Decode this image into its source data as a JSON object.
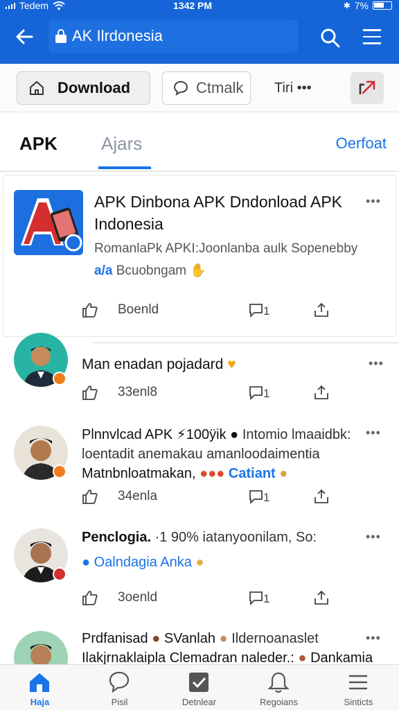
{
  "status_bar": {
    "carrier": "Tedem",
    "time": "1342 PM",
    "battery": "7%"
  },
  "app_bar": {
    "address": "AK Ilrdonesia"
  },
  "actions": {
    "download_label": "Download",
    "comment_label": "Ctmalk",
    "tiri_label": "Tiri •••"
  },
  "tabs": {
    "apk": "APK",
    "ajars": "Ajars",
    "download": "Oerfoat"
  },
  "featured": {
    "title_line1": "APK Dinbona APK Dndonload APK",
    "title_line2": "Indonesia",
    "subtitle": "RomanlaPk APKI:Joonlanba  aulk Sopenebby",
    "tag_prefix": "a/a",
    "tag_text": "Bcuobngam",
    "reaction_count": "Boenld",
    "comment_count": "1"
  },
  "posts": [
    {
      "line1": "Man enadan pojadard",
      "line2": "",
      "line3": "",
      "reaction_count": "33enl8",
      "comment_count": "1"
    },
    {
      "line1": "Plnnvlcad APK ⚡100ÿik",
      "line1_right": "Intomio lmaaidbk:",
      "line2": "loentadit anemakau amanloodaimentia",
      "line3": "Matnbnloatmakan,",
      "line3_tag": "Catiant",
      "reaction_count": "34enla",
      "comment_count": "1"
    },
    {
      "line1": "Penclogia.",
      "line1_rest": "·1 90% iatanyoonilam, So:",
      "line2_tag": "Oalndagia Anka",
      "reaction_count": "3oenld",
      "comment_count": "1"
    },
    {
      "line1": "Prdfanisad",
      "line1_mid": "SVanlah",
      "line1_right": "Ildernoanaslet",
      "line2": "Ilakjrnaklaipla Clemadran naleder.:",
      "line2_right": "Dankamia"
    }
  ],
  "bottom_nav": {
    "items": [
      {
        "label": "Haja",
        "icon": "home-icon"
      },
      {
        "label": "Pisil",
        "icon": "chat-bubble-icon"
      },
      {
        "label": "Detnlear",
        "icon": "checkbox-icon"
      },
      {
        "label": "Regoians",
        "icon": "bell-icon"
      },
      {
        "label": "Sinticts",
        "icon": "hamburger-icon"
      }
    ]
  },
  "colors": {
    "primary": "#1565d8",
    "accent": "#1a73e8"
  }
}
